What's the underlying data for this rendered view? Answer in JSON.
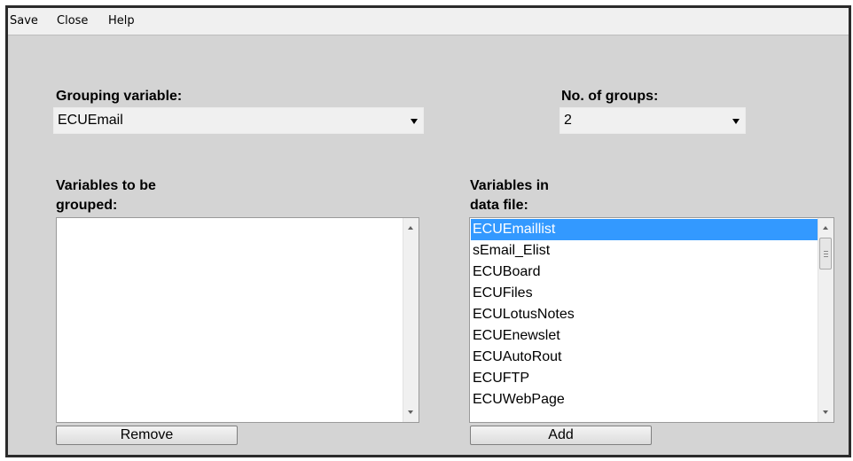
{
  "menu": {
    "save": "Save",
    "close": "Close",
    "help": "Help"
  },
  "grouping": {
    "label": "Grouping variable:",
    "value": "ECUEmail"
  },
  "groups": {
    "label": "No. of groups:",
    "value": "2"
  },
  "grouped": {
    "label_line1": "Variables to be",
    "label_line2": "grouped:",
    "items": [],
    "remove_label": "Remove"
  },
  "datafile": {
    "label_line1": "Variables in",
    "label_line2": "data file:",
    "items": [
      "ECUEmaillist",
      "sEmail_Elist",
      "ECUBoard",
      "ECUFiles",
      "ECULotusNotes",
      "ECUEnewslet",
      "ECUAutoRout",
      "ECUFTP",
      "ECUWebPage"
    ],
    "selected_index": 0,
    "add_label": "Add"
  },
  "colors": {
    "selection": "#3399ff",
    "panel": "#d4d4d4"
  }
}
